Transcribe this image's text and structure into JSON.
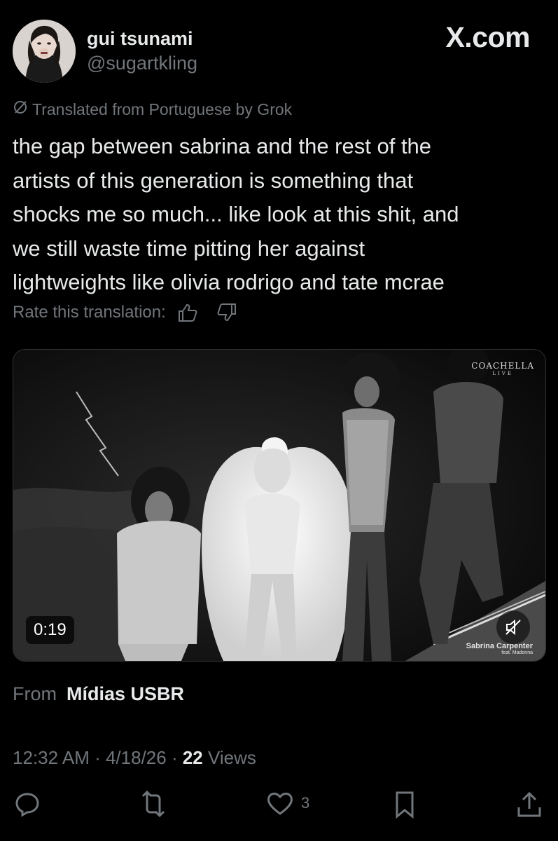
{
  "user": {
    "display_name": "gui tsunami",
    "handle": "@sugartkling",
    "avatar_icon": "avatar"
  },
  "site": {
    "brand": "X.com"
  },
  "translation": {
    "notice": "Translated from Portuguese by Grok",
    "rate_label": "Rate this translation:"
  },
  "tweet": {
    "text_lines": [
      "the gap between sabrina and the rest of the",
      "artists of this generation is something that",
      "shocks me so much... like look at this shit, and",
      "we still waste time pitting her against",
      "lightweights like olivia rodrigo and tate mcrae"
    ]
  },
  "media": {
    "duration": "0:19",
    "watermark_top": "COACHELLA",
    "watermark_top_sub": "LIVE",
    "watermark_bottom": "Sabrina Carpenter",
    "watermark_bottom_sub": "feat. Madonna"
  },
  "source": {
    "label": "From",
    "name": "Mídias USBR"
  },
  "meta": {
    "time": "12:32 AM",
    "sep1": " · ",
    "date": "4/18/26",
    "sep2": " · ",
    "views_count": "22",
    "views_label": " Views"
  },
  "actions": {
    "reply_icon": "reply-icon",
    "retweet_icon": "retweet-icon",
    "like_icon": "heart-icon",
    "like_count": "3",
    "bookmark_icon": "bookmark-icon",
    "share_icon": "share-icon"
  },
  "colors": {
    "background": "#000000",
    "text_primary": "#e7e9ea",
    "text_secondary": "#71767b"
  }
}
